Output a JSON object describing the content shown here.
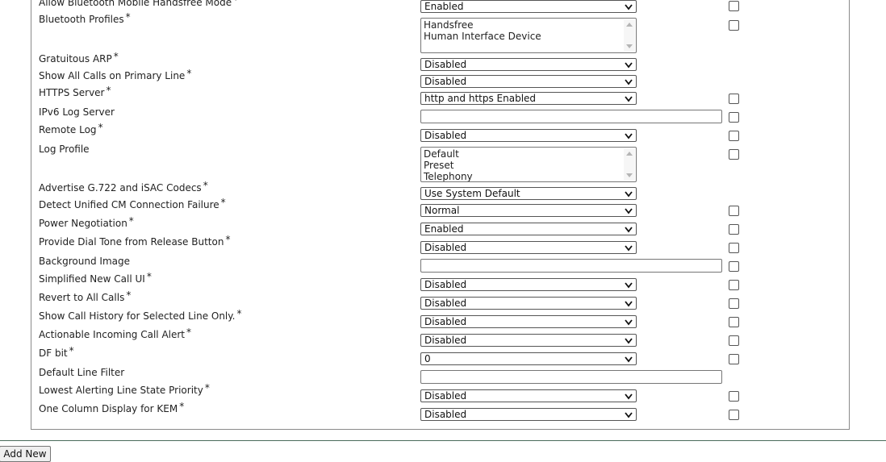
{
  "rows": [
    {
      "label": "Allow Bluetooth Mobile Handsfree Mode",
      "required": "*",
      "control": "select",
      "value": "Enabled",
      "checkbox": true
    },
    {
      "label": "Bluetooth Profiles",
      "required": "*",
      "control": "listbox",
      "options": [
        "Handsfree",
        "Human Interface Device"
      ],
      "checkbox": true
    },
    {
      "label": "Gratuitous ARP",
      "required": "*",
      "control": "select",
      "value": "Disabled",
      "checkbox": false
    },
    {
      "label": "Show All Calls on Primary Line",
      "required": "*",
      "control": "select",
      "value": "Disabled",
      "checkbox": false
    },
    {
      "label": "HTTPS Server",
      "required": "*",
      "control": "select",
      "value": "http and https Enabled",
      "checkbox": true
    },
    {
      "label": "IPv6 Log Server",
      "required": "",
      "control": "text",
      "value": "",
      "checkbox": true
    },
    {
      "label": "Remote Log",
      "required": "*",
      "control": "select",
      "value": "Disabled",
      "checkbox": true
    },
    {
      "label": "Log Profile",
      "required": "",
      "control": "listbox",
      "options": [
        "Default",
        "Preset",
        "Telephony"
      ],
      "checkbox": true
    },
    {
      "label": "Advertise G.722 and iSAC Codecs",
      "required": "*",
      "control": "select",
      "value": "Use System Default",
      "checkbox": false
    },
    {
      "label": "Detect Unified CM Connection Failure",
      "required": "*",
      "control": "select",
      "value": "Normal",
      "checkbox": true
    },
    {
      "label": "Power Negotiation",
      "required": "*",
      "control": "select",
      "value": "Enabled",
      "checkbox": true
    },
    {
      "label": "Provide Dial Tone from Release Button",
      "required": "*",
      "control": "select",
      "value": "Disabled",
      "checkbox": true
    },
    {
      "label": "Background Image",
      "required": "",
      "control": "text",
      "value": "",
      "checkbox": true
    },
    {
      "label": "Simplified New Call UI",
      "required": "*",
      "control": "select",
      "value": "Disabled",
      "checkbox": true
    },
    {
      "label": "Revert to All Calls",
      "required": "*",
      "control": "select",
      "value": "Disabled",
      "checkbox": true
    },
    {
      "label": "Show Call History for Selected Line Only.",
      "required": "*",
      "control": "select",
      "value": "Disabled",
      "checkbox": true
    },
    {
      "label": "Actionable Incoming Call Alert",
      "required": "*",
      "control": "select",
      "value": "Disabled",
      "checkbox": true
    },
    {
      "label": "DF bit",
      "required": "*",
      "control": "select",
      "value": "0",
      "checkbox": true
    },
    {
      "label": "Default Line Filter",
      "required": "",
      "control": "text",
      "value": "",
      "checkbox": false
    },
    {
      "label": "Lowest Alerting Line State Priority",
      "required": "*",
      "control": "select",
      "value": "Disabled",
      "checkbox": true
    },
    {
      "label": "One Column Display for KEM",
      "required": "*",
      "control": "select",
      "value": "Disabled",
      "checkbox": true
    }
  ],
  "footer": {
    "add_new_label": "Add New"
  }
}
